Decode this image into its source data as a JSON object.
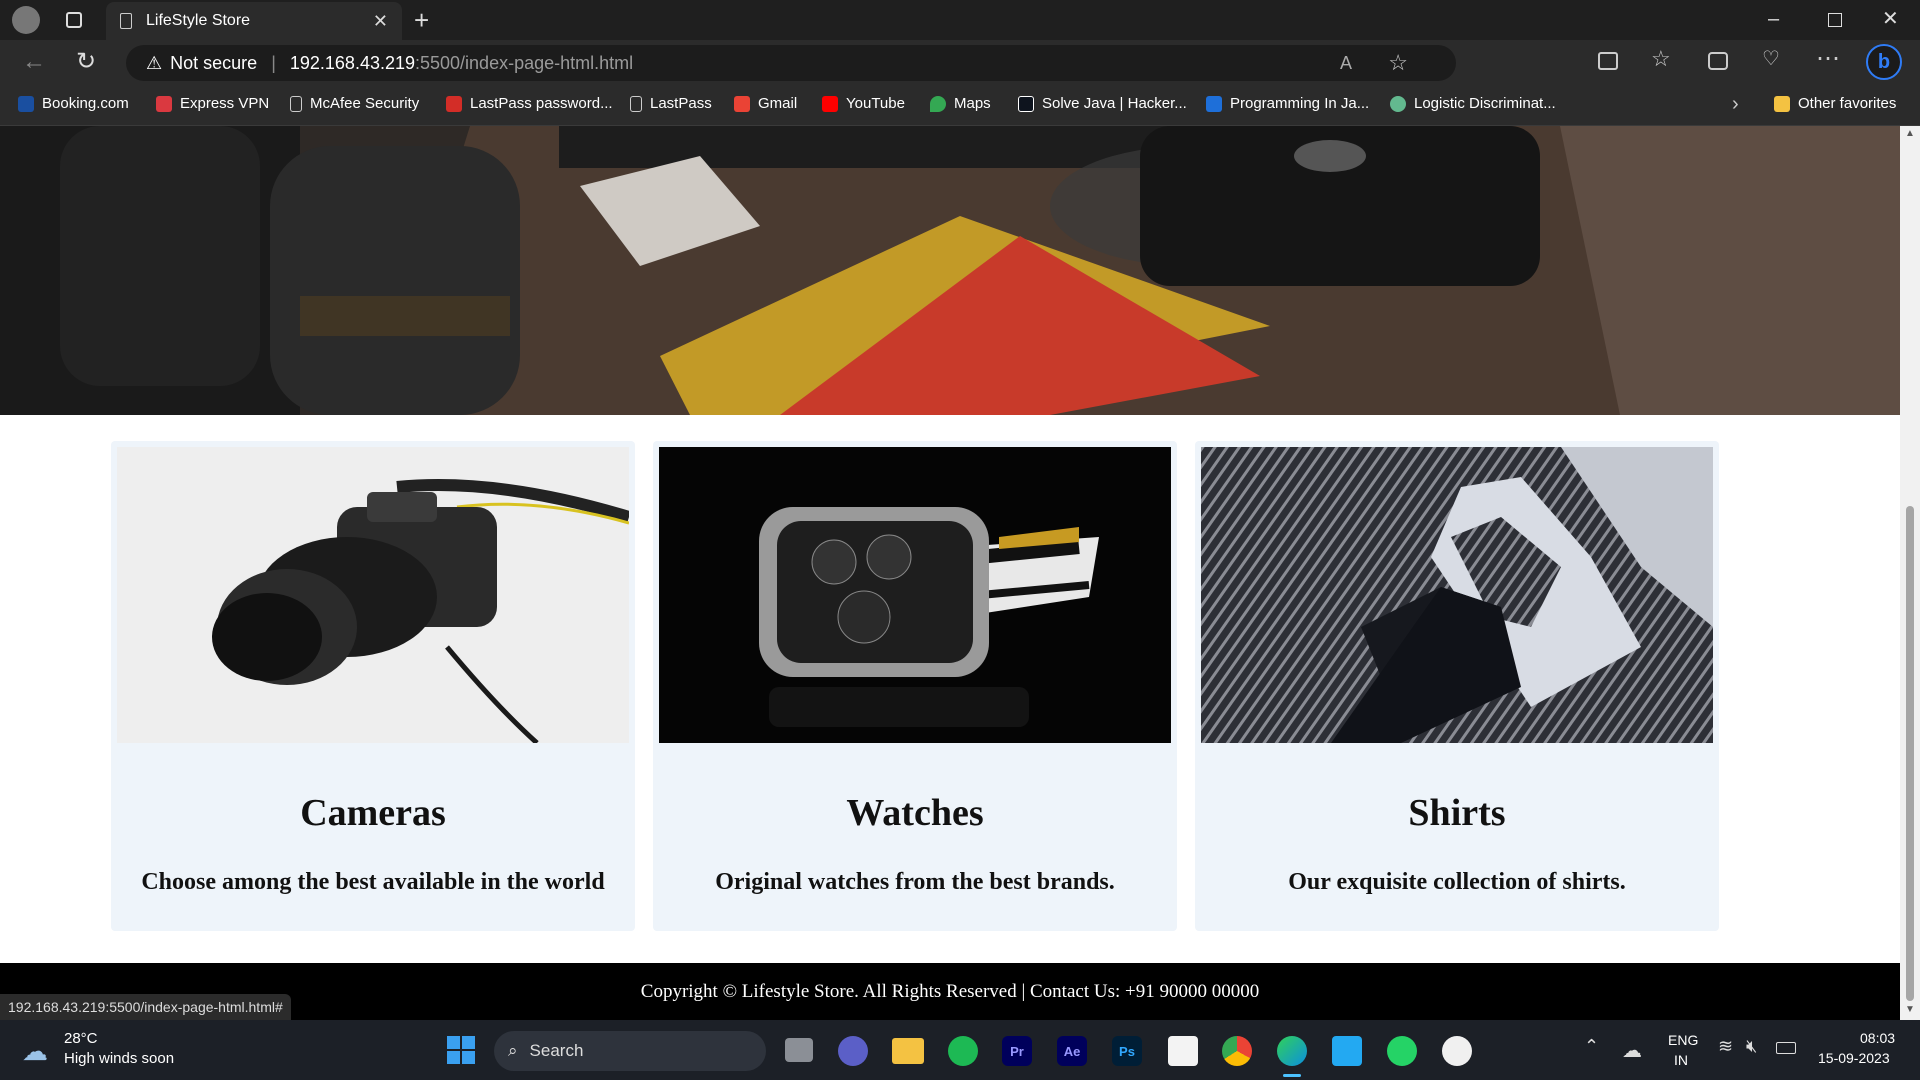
{
  "browser": {
    "tab_title": "LifeStyle Store",
    "security_label": "Not secure",
    "url_host": "192.168.43.219",
    "url_rest": ":5500/index-page-html.html",
    "bookmarks": [
      {
        "label": "Booking.com",
        "color": "#1a4fa0"
      },
      {
        "label": "Express VPN",
        "color": "#da3940"
      },
      {
        "label": "McAfee Security",
        "color": "#3a3a3a"
      },
      {
        "label": "LastPass password...",
        "color": "#d32d27"
      },
      {
        "label": "LastPass",
        "color": "#3a3a3a"
      },
      {
        "label": "Gmail",
        "color": "#ea4335"
      },
      {
        "label": "YouTube",
        "color": "#ff0000"
      },
      {
        "label": "Maps",
        "color": "#34a853"
      },
      {
        "label": "Solve Java | Hacker...",
        "color": "#0e141e"
      },
      {
        "label": "Programming In Ja...",
        "color": "#1e6fd9"
      },
      {
        "label": "Logistic Discriminat...",
        "color": "#63b98f"
      }
    ],
    "other_favorites": "Other favorites",
    "status_url": "192.168.43.219:5500/index-page-html.html#"
  },
  "page": {
    "cards": [
      {
        "title": "Cameras",
        "description": "Choose among the best available in the world"
      },
      {
        "title": "Watches",
        "description": "Original watches from the best brands."
      },
      {
        "title": "Shirts",
        "description": "Our exquisite collection of shirts."
      }
    ],
    "footer": "Copyright © Lifestyle Store. All Rights Reserved | Contact Us: +91 90000 00000"
  },
  "taskbar": {
    "weather_temp": "28°C",
    "weather_text": "High winds soon",
    "search_label": "Search",
    "lang_top": "ENG",
    "lang_bottom": "IN",
    "time": "08:03",
    "date": "15-09-2023"
  },
  "colors": {
    "accent_blue": "#0078d4",
    "card_bg": "#eef4fa",
    "footer_bg": "#000000"
  }
}
